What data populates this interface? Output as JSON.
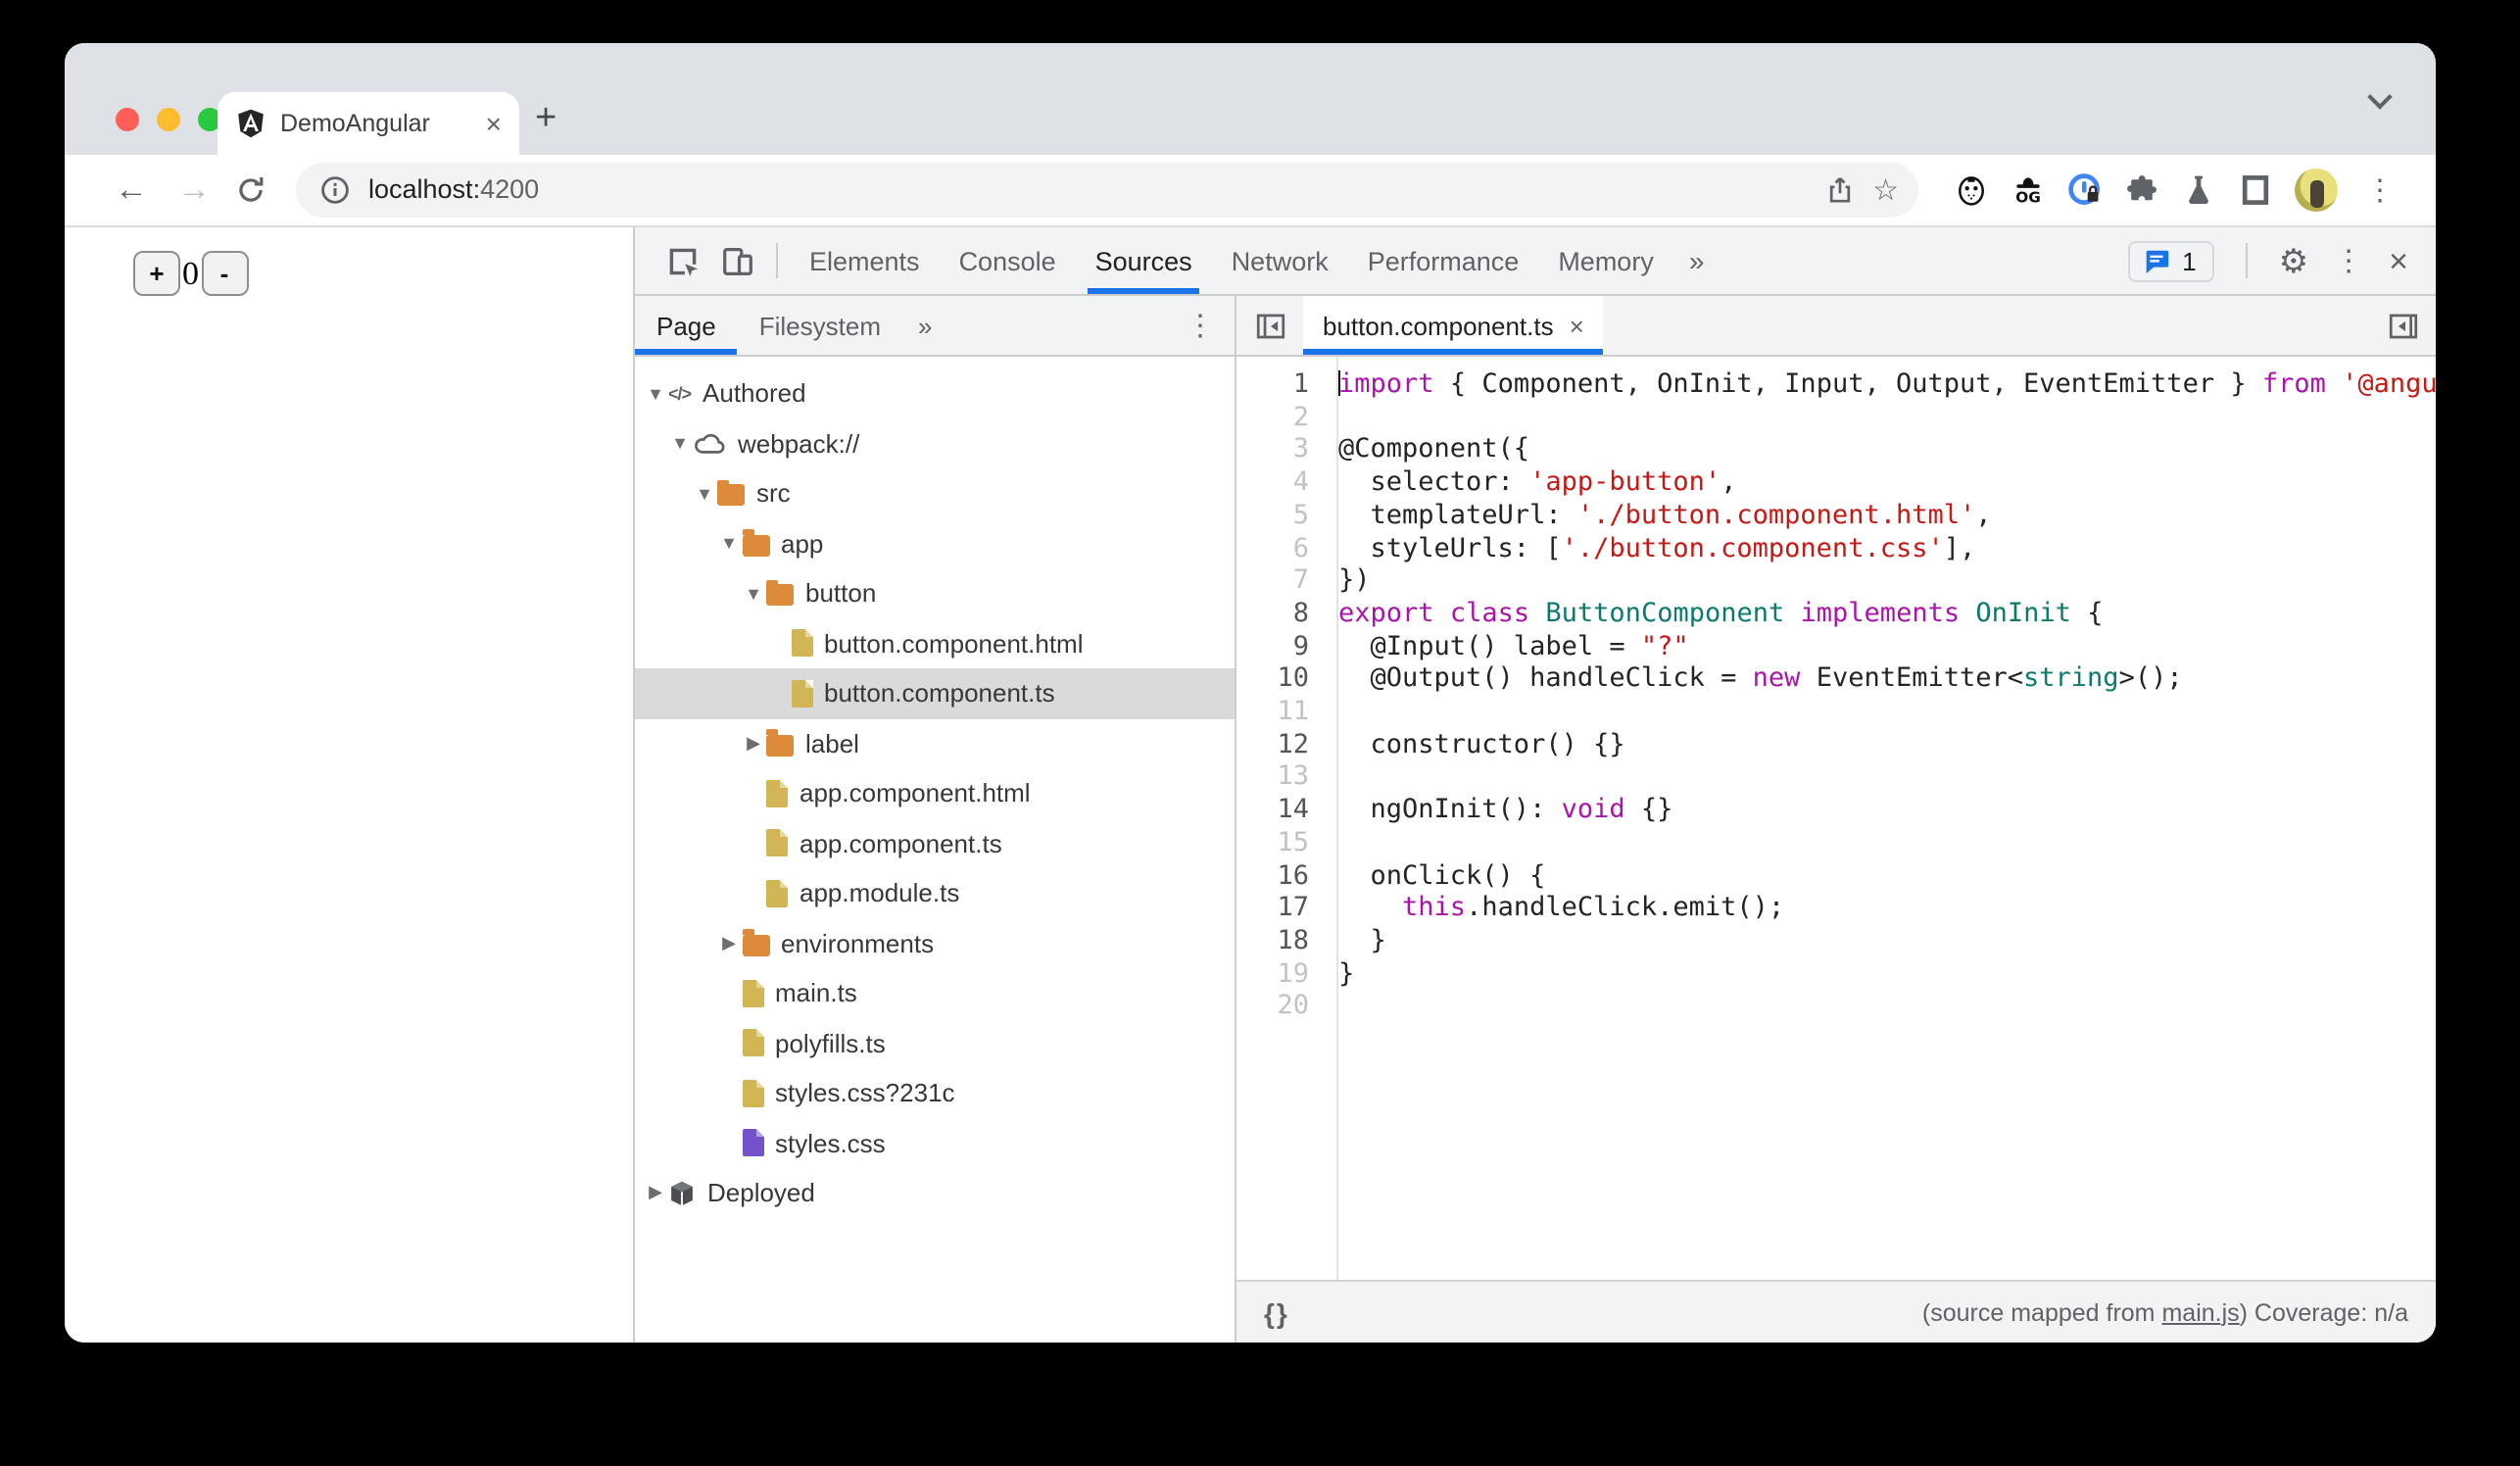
{
  "browser": {
    "tab_title": "DemoAngular",
    "tab_close": "×",
    "new_tab": "+",
    "nav": {
      "back": "←",
      "forward": "→"
    },
    "url": {
      "host": "localhost:",
      "port": "4200"
    }
  },
  "page": {
    "increment_label": "+",
    "count_value": "0",
    "decrement_label": "-"
  },
  "devtools": {
    "tabs": [
      "Elements",
      "Console",
      "Sources",
      "Network",
      "Performance",
      "Memory"
    ],
    "active_tab": "Sources",
    "more_tabs": "»",
    "issues_count": "1",
    "sidebar": {
      "tabs": [
        "Page",
        "Filesystem"
      ],
      "active_tab": "Page",
      "more_tabs": "»",
      "tree": [
        {
          "label": "Authored",
          "depth": 0,
          "icon": "code",
          "expander": "open"
        },
        {
          "label": "webpack://",
          "depth": 1,
          "icon": "cloud",
          "expander": "open"
        },
        {
          "label": "src",
          "depth": 2,
          "icon": "folder",
          "expander": "open"
        },
        {
          "label": "app",
          "depth": 3,
          "icon": "folder",
          "expander": "open"
        },
        {
          "label": "button",
          "depth": 4,
          "icon": "folder",
          "expander": "open"
        },
        {
          "label": "button.component.html",
          "depth": 5,
          "icon": "file"
        },
        {
          "label": "button.component.ts",
          "depth": 5,
          "icon": "file",
          "selected": true
        },
        {
          "label": "label",
          "depth": 4,
          "icon": "folder",
          "expander": "closed"
        },
        {
          "label": "app.component.html",
          "depth": 4,
          "icon": "file"
        },
        {
          "label": "app.component.ts",
          "depth": 4,
          "icon": "file"
        },
        {
          "label": "app.module.ts",
          "depth": 4,
          "icon": "file"
        },
        {
          "label": "environments",
          "depth": 3,
          "icon": "folder",
          "expander": "closed"
        },
        {
          "label": "main.ts",
          "depth": 3,
          "icon": "file"
        },
        {
          "label": "polyfills.ts",
          "depth": 3,
          "icon": "file"
        },
        {
          "label": "styles.css?231c",
          "depth": 3,
          "icon": "file"
        },
        {
          "label": "styles.css",
          "depth": 3,
          "icon": "file-purple"
        },
        {
          "label": "Deployed",
          "depth": 0,
          "icon": "package",
          "expander": "closed"
        }
      ]
    },
    "editor": {
      "tab_label": "button.component.ts",
      "tab_close": "×",
      "lines": [
        {
          "n": 1,
          "mapped": true,
          "tokens": [
            [
              "k",
              "import"
            ],
            [
              "p",
              " { Component, OnInit, Input, Output, EventEmitter } "
            ],
            [
              "k",
              "from"
            ],
            [
              "p",
              " "
            ],
            [
              "s",
              "'@angular/core';"
            ]
          ]
        },
        {
          "n": 2,
          "mapped": false,
          "tokens": []
        },
        {
          "n": 3,
          "mapped": false,
          "tokens": [
            [
              "p",
              "@Component({"
            ]
          ]
        },
        {
          "n": 4,
          "mapped": false,
          "tokens": [
            [
              "p",
              "  selector: "
            ],
            [
              "s",
              "'app-button'"
            ],
            [
              "p",
              ","
            ]
          ]
        },
        {
          "n": 5,
          "mapped": false,
          "tokens": [
            [
              "p",
              "  templateUrl: "
            ],
            [
              "s",
              "'./button.component.html'"
            ],
            [
              "p",
              ","
            ]
          ]
        },
        {
          "n": 6,
          "mapped": false,
          "tokens": [
            [
              "p",
              "  styleUrls: ["
            ],
            [
              "s",
              "'./button.component.css'"
            ],
            [
              "p",
              "],"
            ]
          ]
        },
        {
          "n": 7,
          "mapped": false,
          "tokens": [
            [
              "p",
              "})"
            ]
          ]
        },
        {
          "n": 8,
          "mapped": true,
          "tokens": [
            [
              "k",
              "export"
            ],
            [
              "p",
              " "
            ],
            [
              "k",
              "class"
            ],
            [
              "p",
              " "
            ],
            [
              "t",
              "ButtonComponent"
            ],
            [
              "p",
              " "
            ],
            [
              "k",
              "implements"
            ],
            [
              "p",
              " "
            ],
            [
              "t",
              "OnInit"
            ],
            [
              "p",
              " {"
            ]
          ]
        },
        {
          "n": 9,
          "mapped": true,
          "tokens": [
            [
              "p",
              "  @Input() label = "
            ],
            [
              "s",
              "\"?\""
            ]
          ]
        },
        {
          "n": 10,
          "mapped": true,
          "tokens": [
            [
              "p",
              "  @Output() handleClick = "
            ],
            [
              "k",
              "new"
            ],
            [
              "p",
              " EventEmitter<"
            ],
            [
              "t",
              "string"
            ],
            [
              "p",
              ">();"
            ]
          ]
        },
        {
          "n": 11,
          "mapped": false,
          "tokens": []
        },
        {
          "n": 12,
          "mapped": true,
          "tokens": [
            [
              "p",
              "  constructor() {}"
            ]
          ]
        },
        {
          "n": 13,
          "mapped": false,
          "tokens": []
        },
        {
          "n": 14,
          "mapped": true,
          "tokens": [
            [
              "p",
              "  ngOnInit(): "
            ],
            [
              "k",
              "void"
            ],
            [
              "p",
              " {}"
            ]
          ]
        },
        {
          "n": 15,
          "mapped": false,
          "tokens": []
        },
        {
          "n": 16,
          "mapped": true,
          "tokens": [
            [
              "p",
              "  onClick() {"
            ]
          ]
        },
        {
          "n": 17,
          "mapped": true,
          "tokens": [
            [
              "p",
              "    "
            ],
            [
              "k",
              "this"
            ],
            [
              "p",
              ".handleClick.emit();"
            ]
          ]
        },
        {
          "n": 18,
          "mapped": true,
          "tokens": [
            [
              "p",
              "  }"
            ]
          ]
        },
        {
          "n": 19,
          "mapped": false,
          "tokens": [
            [
              "p",
              "}"
            ]
          ]
        },
        {
          "n": 20,
          "mapped": false,
          "tokens": []
        }
      ],
      "status_left": "{}",
      "status_pre": "(source mapped from ",
      "status_link": "main.js",
      "status_post": ") Coverage: n/a"
    }
  },
  "colors": {
    "accent_blue": "#1a73e8",
    "keyword": "#a815a8",
    "string": "#c41a16",
    "type": "#0d7a6e",
    "folder": "#dd8b3a",
    "file_yellow": "#d2b655",
    "file_purple": "#7352cc",
    "selection_gray": "#dadada",
    "traffic_red": "#ff5f57",
    "traffic_yellow": "#febc2e",
    "traffic_green": "#28c840"
  }
}
